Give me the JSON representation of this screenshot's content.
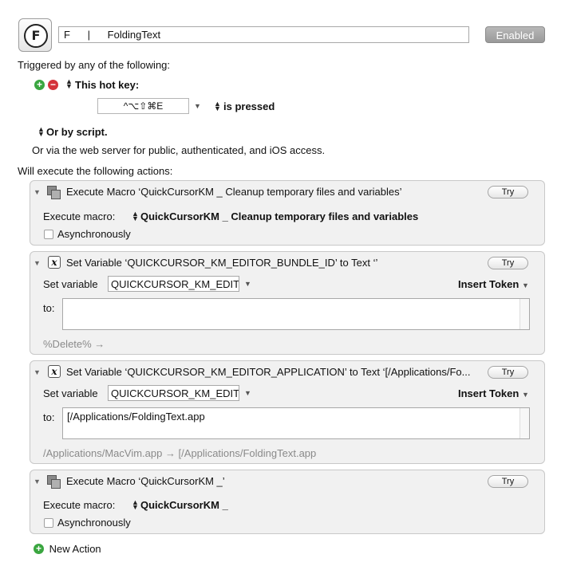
{
  "macro": {
    "name_value": "F      |      FoldingText",
    "enabled_label": "Enabled"
  },
  "triggers": {
    "heading": "Triggered by any of the following:",
    "hotkey_label": "This hot key:",
    "hotkey_value": "^⌥⇧⌘E",
    "hotkey_condition": "is pressed",
    "script_label": "Or by script.",
    "web_server_text": "Or via the web server for public, authenticated, and iOS access."
  },
  "actions_heading": "Will execute the following actions:",
  "actions": [
    {
      "title": "Execute Macro ‘QuickCursorKM _ Cleanup temporary files and variables’",
      "try_label": "Try",
      "field_label": "Execute macro:",
      "macro_value": "QuickCursorKM _ Cleanup temporary files and variables",
      "async_label": "Asynchronously"
    },
    {
      "title": "Set Variable ‘QUICKCURSOR_KM_EDITOR_BUNDLE_ID’ to Text ‘’",
      "try_label": "Try",
      "field_label": "Set variable",
      "variable_value": "QUICKCURSOR_KM_EDITOR_BUNDLE_ID",
      "insert_token_label": "Insert Token",
      "to_label": "to:",
      "to_value": "",
      "preview": "%Delete% →"
    },
    {
      "title": "Set Variable ‘QUICKCURSOR_KM_EDITOR_APPLICATION’ to Text ‘[/Applications/Fo...",
      "try_label": "Try",
      "field_label": "Set variable",
      "variable_value": "QUICKCURSOR_KM_EDITOR_APPLICATION",
      "insert_token_label": "Insert Token",
      "to_label": "to:",
      "to_value": "[/Applications/FoldingText.app",
      "preview": "/Applications/MacVim.app → [/Applications/FoldingText.app"
    },
    {
      "title": "Execute Macro ‘QuickCursorKM _’",
      "try_label": "Try",
      "field_label": "Execute macro:",
      "macro_value": "QuickCursorKM _",
      "async_label": "Asynchronously"
    }
  ],
  "new_action_label": "New Action"
}
